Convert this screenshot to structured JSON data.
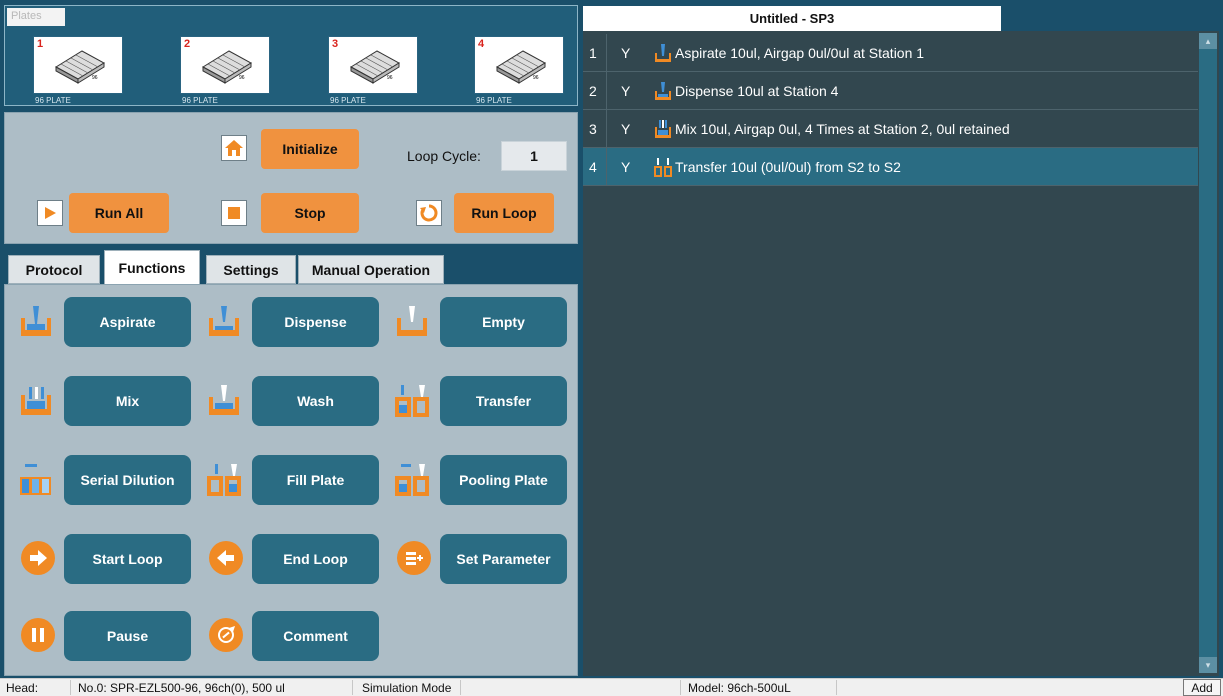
{
  "plates": {
    "title": "Plates",
    "items": [
      {
        "number": "1",
        "label": "96 PLATE"
      },
      {
        "number": "2",
        "label": "96 PLATE"
      },
      {
        "number": "3",
        "label": "96 PLATE"
      },
      {
        "number": "4",
        "label": "96 PLATE"
      }
    ]
  },
  "controls": {
    "initialize_label": "Initialize",
    "loop_cycle_label": "Loop Cycle:",
    "loop_cycle_value": "1",
    "run_all_label": "Run All",
    "stop_label": "Stop",
    "run_loop_label": "Run Loop"
  },
  "tabs": [
    {
      "label": "Protocol"
    },
    {
      "label": "Functions"
    },
    {
      "label": "Settings"
    },
    {
      "label": "Manual Operation"
    }
  ],
  "functions": [
    {
      "label": "Aspirate",
      "icon": "aspirate-icon"
    },
    {
      "label": "Dispense",
      "icon": "dispense-icon"
    },
    {
      "label": "Empty",
      "icon": "empty-icon"
    },
    {
      "label": "Mix",
      "icon": "mix-icon"
    },
    {
      "label": "Wash",
      "icon": "wash-icon"
    },
    {
      "label": "Transfer",
      "icon": "transfer-icon"
    },
    {
      "label": "Serial Dilution",
      "icon": "serial-dilution-icon"
    },
    {
      "label": "Fill Plate",
      "icon": "fill-plate-icon"
    },
    {
      "label": "Pooling Plate",
      "icon": "pooling-plate-icon"
    },
    {
      "label": "Start Loop",
      "icon": "arrow-right-icon"
    },
    {
      "label": "End Loop",
      "icon": "arrow-left-icon"
    },
    {
      "label": "Set Parameter",
      "icon": "set-parameter-icon"
    },
    {
      "label": "Pause",
      "icon": "pause-icon"
    },
    {
      "label": "Comment",
      "icon": "comment-icon"
    }
  ],
  "protocol": {
    "title": "Untitled - SP3",
    "steps": [
      {
        "num": "1",
        "enabled": "Y",
        "text": "Aspirate 10ul, Airgap 0ul/0ul at Station 1"
      },
      {
        "num": "2",
        "enabled": "Y",
        "text": "Dispense 10ul at Station 4"
      },
      {
        "num": "3",
        "enabled": "Y",
        "text": "Mix 10ul, Airgap 0ul, 4 Times at Station 2, 0ul retained"
      },
      {
        "num": "4",
        "enabled": "Y",
        "text": "Transfer 10ul (0ul/0ul) from S2 to S2"
      }
    ]
  },
  "status": {
    "head_label": "Head:",
    "head_value": "No.0: SPR-EZL500-96, 96ch(0), 500 ul",
    "mode": "Simulation Mode",
    "model": "Model: 96ch-500uL",
    "add_label": "Add"
  },
  "colors": {
    "accent_orange": "#f0923f",
    "function_button": "#2a6c83",
    "panel_bg": "#adbdc6",
    "list_bg": "#32474f"
  }
}
